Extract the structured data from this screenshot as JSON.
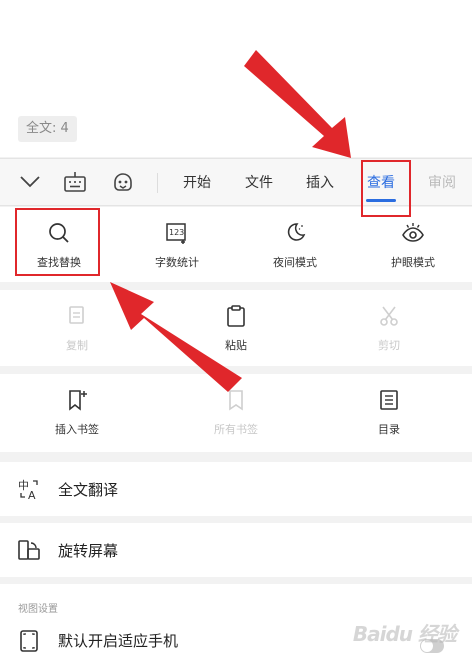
{
  "document": {
    "word_count": "全文: 4"
  },
  "toolbar": {
    "tabs": [
      {
        "label": "开始"
      },
      {
        "label": "文件"
      },
      {
        "label": "插入"
      },
      {
        "label": "查看"
      },
      {
        "label": "审阅"
      }
    ],
    "active_tab": "查看"
  },
  "view_tools": [
    {
      "label": "查找替换",
      "icon": "search-icon"
    },
    {
      "label": "字数统计",
      "icon": "word-count-icon"
    },
    {
      "label": "夜间模式",
      "icon": "moon-icon"
    },
    {
      "label": "护眼模式",
      "icon": "eye-icon"
    }
  ],
  "clipboard_tools": [
    {
      "label": "复制",
      "icon": "copy-icon",
      "disabled": true
    },
    {
      "label": "粘贴",
      "icon": "clipboard-icon",
      "disabled": false
    },
    {
      "label": "剪切",
      "icon": "scissors-icon",
      "disabled": true
    }
  ],
  "bookmark_tools": [
    {
      "label": "插入书签",
      "icon": "bookmark-add-icon",
      "disabled": false
    },
    {
      "label": "所有书签",
      "icon": "bookmark-icon",
      "disabled": true
    },
    {
      "label": "目录",
      "icon": "toc-icon",
      "disabled": false
    }
  ],
  "list_items": [
    {
      "label": "全文翻译",
      "icon": "translate-icon"
    },
    {
      "label": "旋转屏幕",
      "icon": "rotate-screen-icon"
    }
  ],
  "view_settings": {
    "header": "视图设置",
    "items": [
      {
        "label": "默认开启适应手机",
        "icon": "fit-phone-icon",
        "enabled": false
      }
    ]
  },
  "colors": {
    "accent": "#2b6de0",
    "annotation": "#e0272b"
  },
  "watermark": "Baidu 经验"
}
